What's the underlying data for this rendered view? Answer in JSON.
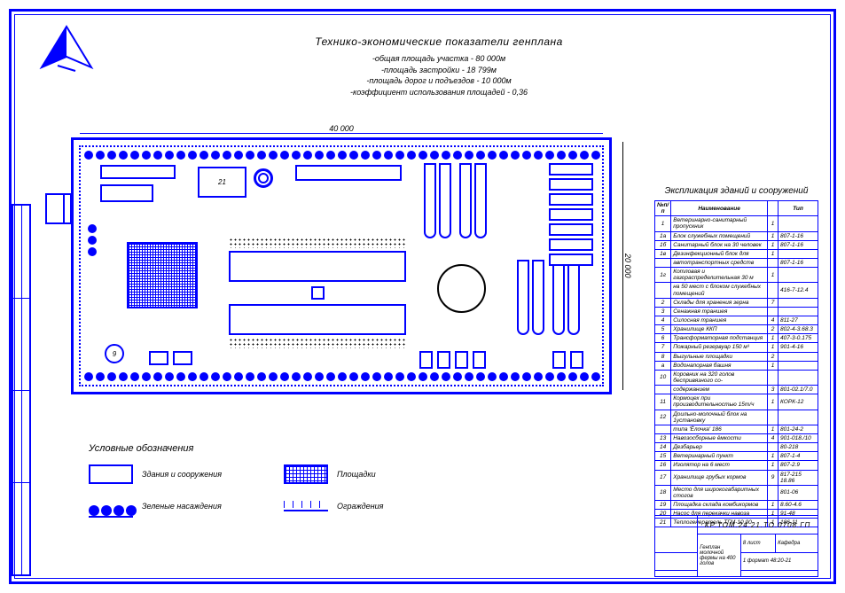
{
  "header": {
    "title": "Технико-экономические показатели генплана",
    "metrics": [
      "-общая площадь участка - 80 000м",
      "-площадь застройки - 18 799м",
      "-площадь дорог и подъездов - 10 000м",
      "-коэффициент использования площадей - 0,36"
    ]
  },
  "dimensions": {
    "width": "40 000",
    "height": "20 000"
  },
  "legend": {
    "title": "Условные обозначения",
    "items": {
      "buildings": "Здания и сооружения",
      "areas": "Площадки",
      "plantings": "Зеленые насаждения",
      "fences": "Ограждения"
    }
  },
  "specification": {
    "title": "Экспликация зданий и сооружений",
    "headers": {
      "no": "№п/п",
      "name": "Наименование",
      "qty": "",
      "type": "Тип"
    },
    "rows": [
      {
        "n": "1",
        "name": "Ветеринарно-санитарный пропускник",
        "q": "1",
        "t": ""
      },
      {
        "n": "1а",
        "name": "Блок служебных помещений",
        "q": "1",
        "t": "807-1-16"
      },
      {
        "n": "1б",
        "name": "Санитарный блок на 30 человек",
        "q": "1",
        "t": "807-1-16"
      },
      {
        "n": "1в",
        "name": "Дезинфекционный блок для",
        "q": "1",
        "t": ""
      },
      {
        "n": "",
        "name": "автотранспортных средств",
        "q": "",
        "t": "807-1-16"
      },
      {
        "n": "1г",
        "name": "Котловая и газораспределительная 30 м",
        "q": "1",
        "t": ""
      },
      {
        "n": "",
        "name": "на 50 мест с блоком служебных помещений",
        "q": "",
        "t": "416-7-12.4"
      },
      {
        "n": "2",
        "name": "Склады для хранения зерна",
        "q": "7",
        "t": ""
      },
      {
        "n": "3",
        "name": "Сенажная траншея",
        "q": "",
        "t": ""
      },
      {
        "n": "4",
        "name": "Силосная траншея",
        "q": "4",
        "t": "811-27"
      },
      {
        "n": "5",
        "name": "Хранилище ККП",
        "q": "2",
        "t": "802-4-3.68.3"
      },
      {
        "n": "6",
        "name": "Трансформаторная подстанция",
        "q": "1",
        "t": "407-3-0.175"
      },
      {
        "n": "7",
        "name": "Пожарный резервуар 150 м³",
        "q": "1",
        "t": "901-4-16"
      },
      {
        "n": "8",
        "name": "Выгульные площадки",
        "q": "2",
        "t": ""
      },
      {
        "n": "а",
        "name": "Водонапорная башня",
        "q": "1",
        "t": ""
      },
      {
        "n": "10",
        "name": "Коровник на 320 голов беспривязного со-",
        "q": "",
        "t": ""
      },
      {
        "n": "",
        "name": "содержанием",
        "q": "3",
        "t": "801-02.1/7.0"
      },
      {
        "n": "11",
        "name": "Кормоцех при производительностью 15т/ч",
        "q": "1",
        "t": "КОРК-12"
      },
      {
        "n": "12",
        "name": "Доильно-молочный блок на 1установку",
        "q": "",
        "t": ""
      },
      {
        "n": "",
        "name": "типа 'Ёлочка' 186",
        "q": "1",
        "t": "801-24-2"
      },
      {
        "n": "13",
        "name": "Навозосборные ёмкости",
        "q": "4",
        "t": "901-018./10"
      },
      {
        "n": "14",
        "name": "Дезбарьер",
        "q": "",
        "t": "80-218"
      },
      {
        "n": "15",
        "name": "Ветеринарный пункт",
        "q": "1",
        "t": "807-1-4"
      },
      {
        "n": "16",
        "name": "Изолятор на 6 мест",
        "q": "1",
        "t": "807-2.9"
      },
      {
        "n": "17",
        "name": "Хранилище грубых кормов",
        "q": "9",
        "t": "817-215 18.86"
      },
      {
        "n": "18",
        "name": "Место для широкогабаритных стогов",
        "q": "",
        "t": "801-06"
      },
      {
        "n": "19",
        "name": "Площадка склада комбикормов",
        "q": "1",
        "t": "8.60-4.6"
      },
      {
        "n": "20",
        "name": "Насос для перекачки навоза",
        "q": "1",
        "t": "91-48"
      },
      {
        "n": "21",
        "name": "Теплогенератель ТГМ-10.00",
        "q": "1",
        "t": "186-11"
      }
    ]
  },
  "titleblock": {
    "code": "КР.ТОМ.24.21.ТО.0708.ГП",
    "project_l1": "Генплан молочной",
    "project_l2": "фермы на 400 голов",
    "sheet": "8 лист",
    "sheets": "1 формат 48:20-21",
    "dept": "Кафедра"
  },
  "plan_labels": {
    "b21": "21",
    "b9": "9"
  }
}
